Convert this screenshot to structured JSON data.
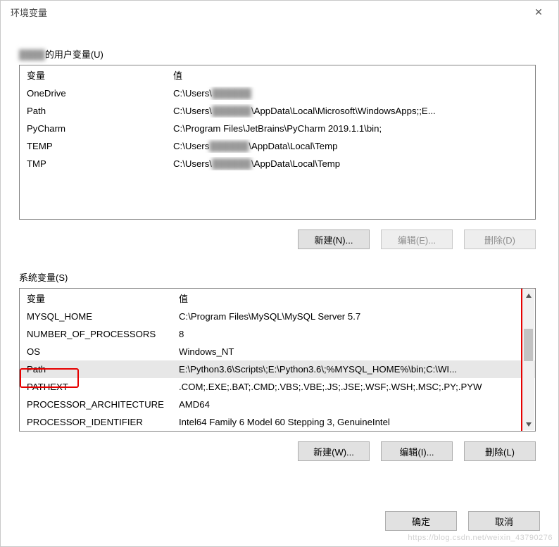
{
  "window": {
    "title": "环境变量",
    "close_icon": "✕"
  },
  "user_section": {
    "label_prefix": "",
    "label_suffix": "的用户变量(U)",
    "columns": {
      "variable": "变量",
      "value": "值"
    },
    "rows": [
      {
        "variable": "OneDrive",
        "value": "C:\\Users\\",
        "blurred_tail": "██████"
      },
      {
        "variable": "Path",
        "value_prefix": "C:\\Users\\",
        "value_mid_blur": "██████",
        "value_suffix": "\\AppData\\Local\\Microsoft\\WindowsApps;;E..."
      },
      {
        "variable": "PyCharm",
        "value": "C:\\Program Files\\JetBrains\\PyCharm 2019.1.1\\bin;"
      },
      {
        "variable": "TEMP",
        "value_prefix": "C:\\Users",
        "value_mid_blur": "██████",
        "value_suffix": "\\AppData\\Local\\Temp"
      },
      {
        "variable": "TMP",
        "value_prefix": "C:\\Users\\",
        "value_mid_blur": "██████",
        "value_suffix": "\\AppData\\Local\\Temp"
      }
    ],
    "buttons": {
      "new": "新建(N)...",
      "edit": "编辑(E)...",
      "delete": "删除(D)"
    }
  },
  "system_section": {
    "label": "系统变量(S)",
    "columns": {
      "variable": "变量",
      "value": "值"
    },
    "rows": [
      {
        "variable": "MYSQL_HOME",
        "value": "C:\\Program Files\\MySQL\\MySQL Server 5.7"
      },
      {
        "variable": "NUMBER_OF_PROCESSORS",
        "value": "8"
      },
      {
        "variable": "OS",
        "value": "Windows_NT"
      },
      {
        "variable": "Path",
        "value": "E:\\Python3.6\\Scripts\\;E:\\Python3.6\\;%MYSQL_HOME%\\bin;C:\\WI...",
        "selected": true,
        "highlighted": true
      },
      {
        "variable": "PATHEXT",
        "value": ".COM;.EXE;.BAT;.CMD;.VBS;.VBE;.JS;.JSE;.WSF;.WSH;.MSC;.PY;.PYW"
      },
      {
        "variable": "PROCESSOR_ARCHITECTURE",
        "value": "AMD64"
      },
      {
        "variable": "PROCESSOR_IDENTIFIER",
        "value": "Intel64 Family 6 Model 60 Stepping 3, GenuineIntel"
      }
    ],
    "buttons": {
      "new": "新建(W)...",
      "edit": "编辑(I)...",
      "delete": "删除(L)"
    }
  },
  "footer": {
    "ok": "确定",
    "cancel": "取消"
  },
  "watermark": "https://blog.csdn.net/weixin_43790276"
}
